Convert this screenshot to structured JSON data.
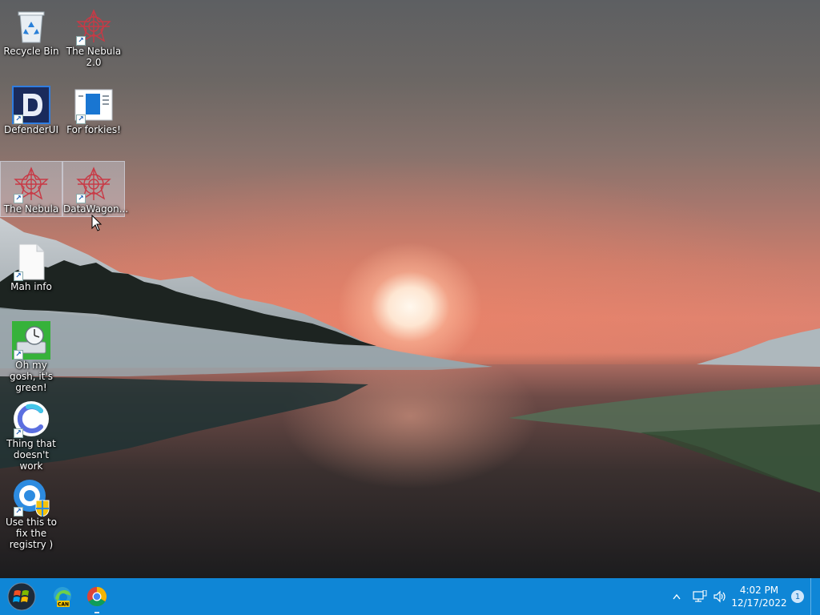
{
  "desktop": {
    "icons": [
      {
        "label": "Recycle Bin",
        "icon": "recycle-bin-icon"
      },
      {
        "label": "The Nebula 2.0",
        "icon": "nebula-icon"
      },
      {
        "label": "DefenderUI",
        "icon": "defenderui-icon"
      },
      {
        "label": "For forkies!",
        "icon": "window-document-icon"
      },
      {
        "label": "The Nebula",
        "icon": "nebula-icon"
      },
      {
        "label": "DataWagon...",
        "icon": "nebula-icon"
      },
      {
        "label": "Mah info",
        "icon": "blank-file-icon"
      },
      {
        "label": "Oh my gosh, it's green!",
        "icon": "green-drive-clock-icon"
      },
      {
        "label": "Thing that doesn't work",
        "icon": "c-logo-icon"
      },
      {
        "label": "Use this to fix the registry )",
        "icon": "registry-shield-icon"
      }
    ],
    "selected": [
      "The Nebula",
      "DataWagon..."
    ]
  },
  "taskbar": {
    "start_icon": "windows-start-icon",
    "pinned": [
      {
        "name": "Microsoft Edge Canary",
        "icon": "edge-canary-icon",
        "badge": "CAN"
      },
      {
        "name": "Google Chrome",
        "icon": "chrome-icon",
        "running": true
      }
    ],
    "tray": {
      "chevron_icon": "chevron-up-icon",
      "network_icon": "network-icon",
      "volume_icon": "volume-icon",
      "time": "4:02 PM",
      "date": "12/17/2022",
      "notification_count": "1"
    }
  },
  "colors": {
    "taskbar": "#0f86d6",
    "selection": "#ced6e2"
  }
}
